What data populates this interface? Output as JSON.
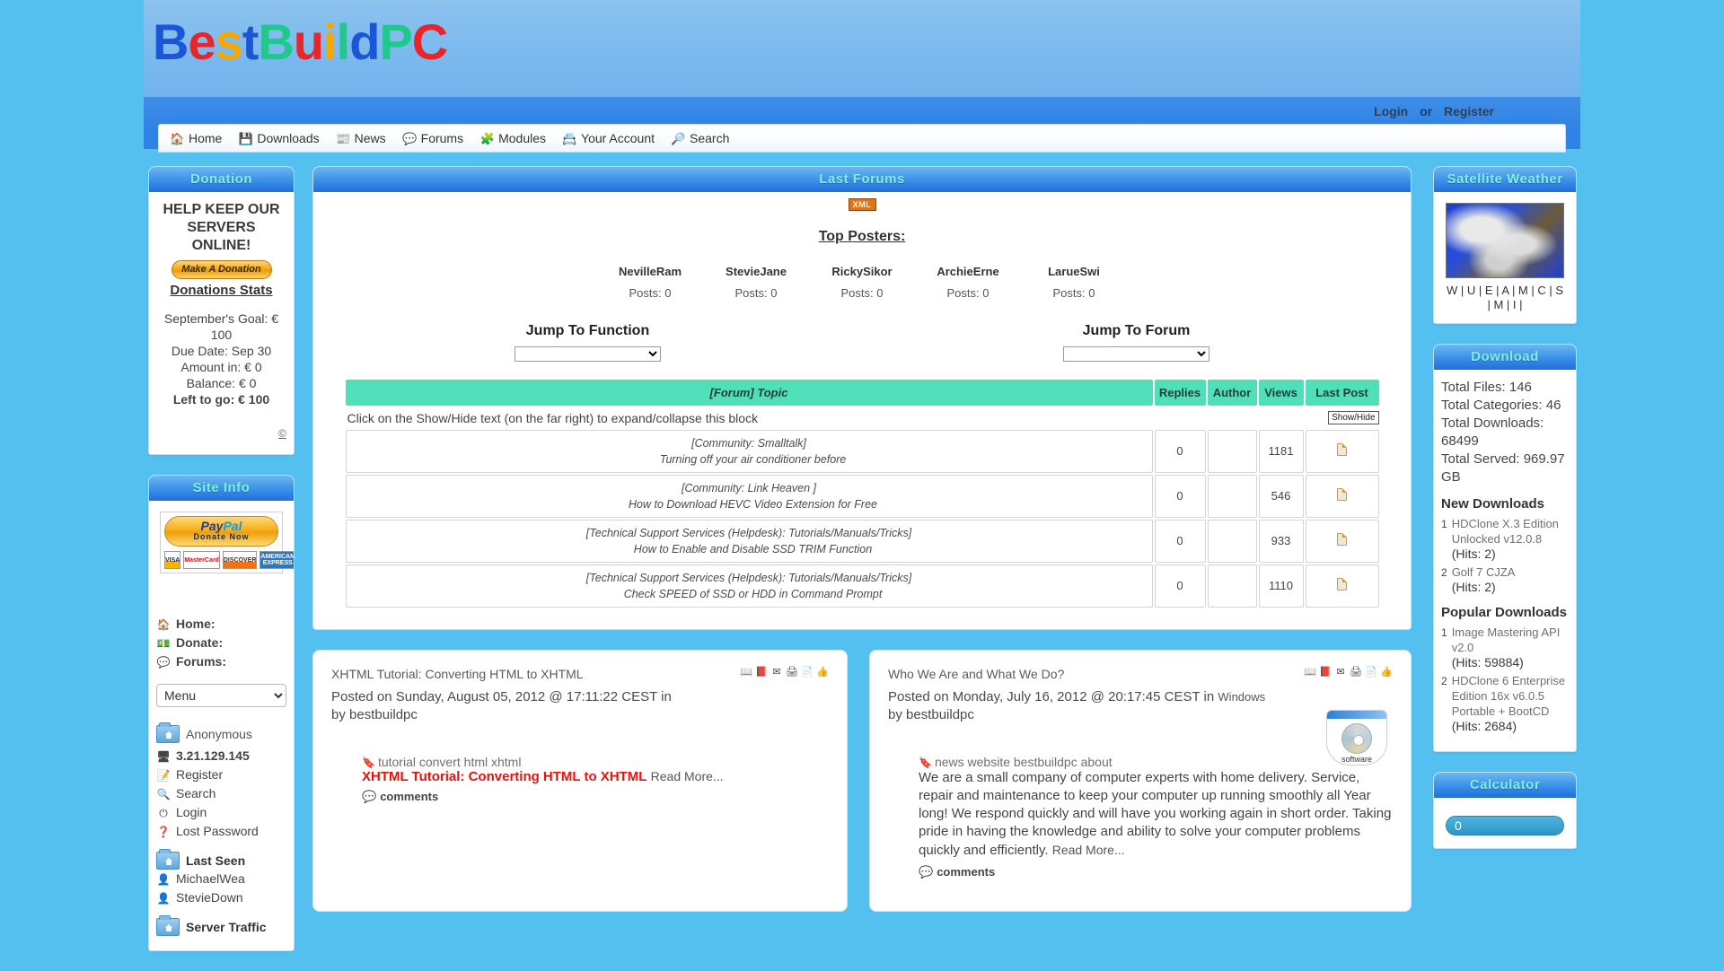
{
  "site": {
    "logo_parts": [
      {
        "t": "B",
        "c": "#1a56d6"
      },
      {
        "t": "e",
        "c": "#e8262a"
      },
      {
        "t": "s",
        "c": "#f5a800"
      },
      {
        "t": "t",
        "c": "#1a56d6"
      },
      {
        "t": "B",
        "c": "#1fc98a"
      },
      {
        "t": "u",
        "c": "#e8262a"
      },
      {
        "t": "i",
        "c": "#f5a800"
      },
      {
        "t": "l",
        "c": "#1fc98a"
      },
      {
        "t": "d",
        "c": "#1a56d6"
      },
      {
        "t": "P",
        "c": "#1fc98a"
      },
      {
        "t": "C",
        "c": "#e8262a"
      }
    ],
    "logo_text": "BestBuildPC"
  },
  "auth": {
    "login": "Login",
    "or": "or",
    "register": "Register"
  },
  "nav": [
    {
      "label": "Home",
      "icon": "home-icon",
      "glyph": "🏠"
    },
    {
      "label": "Downloads",
      "icon": "floppy-icon",
      "glyph": "💾"
    },
    {
      "label": "News",
      "icon": "newspaper-icon",
      "glyph": "📰"
    },
    {
      "label": "Forums",
      "icon": "speech-bubble-icon",
      "glyph": "💬"
    },
    {
      "label": "Modules",
      "icon": "puzzle-icon",
      "glyph": "🧩"
    },
    {
      "label": "Your Account",
      "icon": "id-card-icon",
      "glyph": "📇"
    },
    {
      "label": "Search",
      "icon": "magnifier-icon",
      "glyph": "🔎"
    }
  ],
  "donation": {
    "title": "Donation",
    "headline_1": "HELP KEEP OUR",
    "headline_2": "SERVERS ONLINE!",
    "button": "Make A Donation",
    "stats_link": "Donations Stats",
    "goal": "September's Goal: € 100",
    "due": "Due Date: Sep 30",
    "amount_in": "Amount in: € 0",
    "balance": "Balance: € 0",
    "left_to_go": "Left to go: € 100",
    "copyright": "©"
  },
  "site_info": {
    "title": "Site Info",
    "paypal": {
      "brand_pay": "Pay",
      "brand_pal": "Pal",
      "tm": "™",
      "sub": "Donate Now"
    },
    "cards": [
      "VISA",
      "MasterCard",
      "DISCOVER",
      "AMERICAN EXPRESS"
    ],
    "links": [
      {
        "label": "Home:",
        "icon": "home-icon",
        "glyph": "🏠"
      },
      {
        "label": "Donate:",
        "icon": "donate-icon",
        "glyph": "💵"
      },
      {
        "label": "Forums:",
        "icon": "speech-bubble-icon",
        "glyph": "💬"
      }
    ],
    "menu_select": "Menu",
    "user": "Anonymous",
    "ip": "3.21.129.145",
    "account_links": [
      {
        "label": "Register",
        "icon": "pencil-icon",
        "glyph": "📝"
      },
      {
        "label": "Search",
        "icon": "magnifier-icon",
        "glyph": "🔍"
      },
      {
        "label": "Login",
        "icon": "power-icon",
        "glyph": "⏻"
      },
      {
        "label": "Lost Password",
        "icon": "question-icon",
        "glyph": "❓"
      }
    ],
    "last_seen_title": "Last Seen",
    "last_seen": [
      "MichaelWea",
      "StevieDown"
    ],
    "server_traffic_title": "Server Traffic"
  },
  "forums": {
    "title": "Last Forums",
    "xml_badge": "XML",
    "top_posters_heading": "Top Posters:",
    "posts_label": "Posts: 0",
    "top_posters": [
      {
        "name": "NevilleRam",
        "posts": "Posts: 0"
      },
      {
        "name": "StevieJane",
        "posts": "Posts: 0"
      },
      {
        "name": "RickySikor",
        "posts": "Posts: 0"
      },
      {
        "name": "ArchieErne",
        "posts": "Posts: 0"
      },
      {
        "name": "LarueSwi",
        "posts": "Posts: 0"
      }
    ],
    "jump_function_label": "Jump To Function",
    "jump_forum_label": "Jump To Forum",
    "jump_function_value": "",
    "jump_forum_value": "",
    "columns": [
      "[Forum] Topic",
      "Replies",
      "Author",
      "Views",
      "Last Post"
    ],
    "hint": "Click on the Show/Hide text (on the far right) to expand/collapse this block",
    "showhide": "Show/Hide",
    "rows": [
      {
        "forum": "[Community: Smalltalk]",
        "topic": "Turning off your air conditioner before",
        "replies": "0",
        "author": "",
        "views": "1181"
      },
      {
        "forum": "[Community: Link Heaven ]",
        "topic": "How to Download HEVC Video Extension for Free",
        "replies": "0",
        "author": "",
        "views": "546"
      },
      {
        "forum": "[Technical Support Services (Helpdesk): Tutorials/Manuals/Tricks]",
        "topic": "How to Enable and Disable SSD TRIM Function",
        "replies": "0",
        "author": "",
        "views": "933"
      },
      {
        "forum": "[Technical Support Services (Helpdesk): Tutorials/Manuals/Tricks]",
        "topic": "Check SPEED of SSD or HDD in Command Prompt",
        "replies": "0",
        "author": "",
        "views": "1110"
      }
    ]
  },
  "articles": [
    {
      "title": "XHTML Tutorial: Converting HTML to XHTML",
      "posted": "Posted on Sunday, August 05, 2012 @ 17:11:22 CEST in",
      "category": "",
      "by": "by bestbuildpc",
      "tags": "tutorial convert html xhtml",
      "headline": "XHTML Tutorial: Converting HTML to XHTML",
      "body": "",
      "read_more": "Read More...",
      "comments": "comments"
    },
    {
      "title": "Who We Are and What We Do?",
      "posted": "Posted on Monday, July 16, 2012 @ 20:17:45 CEST in",
      "category": "Windows",
      "by": "by bestbuildpc",
      "tags": "news website bestbuildpc about",
      "headline": "",
      "body": "We are a small company of computer experts with home delivery. Service, repair and maintenance to keep your computer up running smoothly all Year long! We respond quickly and will have you working again in short order. Taking pride in having the knowledge and ability to solve your computer problems quickly and efficiently.",
      "read_more": "Read More...",
      "comments": "comments",
      "image_caption": "software"
    }
  ],
  "article_icons": [
    {
      "name": "book-icon",
      "glyph": "📖"
    },
    {
      "name": "pdf-icon",
      "glyph": "📕"
    },
    {
      "name": "email-icon",
      "glyph": "✉"
    },
    {
      "name": "print-icon",
      "glyph": "🖨"
    },
    {
      "name": "page-icon",
      "glyph": "📄"
    },
    {
      "name": "thumbs-up-icon",
      "glyph": "👍"
    }
  ],
  "satellite": {
    "title": "Satellite Weather",
    "links_line1": "W | U | E | A | M | C | S",
    "links_line2": "| M | I |"
  },
  "download": {
    "title": "Download",
    "total_files": "Total Files: 146",
    "total_categories": "Total Categories: 46",
    "total_downloads": "Total Downloads: 68499",
    "total_served": "Total Served: 969.97 GB",
    "new_heading": "New Downloads",
    "new_items": [
      {
        "n": "1",
        "name": "HDClone X.3 Edition Unlocked v12.0.8",
        "hits": "(Hits: 2)"
      },
      {
        "n": "2",
        "name": "Golf 7 CJZA",
        "hits": "(Hits: 2)"
      }
    ],
    "popular_heading": "Popular Downloads",
    "popular_items": [
      {
        "n": "1",
        "name": "Image Mastering API v2.0",
        "hits": "(Hits: 59884)"
      },
      {
        "n": "2",
        "name": "HDClone 6 Enterprise Edition 16x v6.0.5 Portable + BootCD",
        "hits": "(Hits: 2684)"
      }
    ]
  },
  "calculator": {
    "title": "Calculator",
    "display": "0"
  },
  "colors": {
    "page_background": "#54c0ef",
    "header_band": "#7bb9ee",
    "nav_band": "#2f83e6",
    "block_title_start": "#6fb6ef",
    "block_title_end": "#1f6fdc",
    "block_title_text": "#7ff0e0",
    "table_header": "#4fe0ba",
    "xml_badge": "#e8730c",
    "headline_red": "#e8120c"
  }
}
